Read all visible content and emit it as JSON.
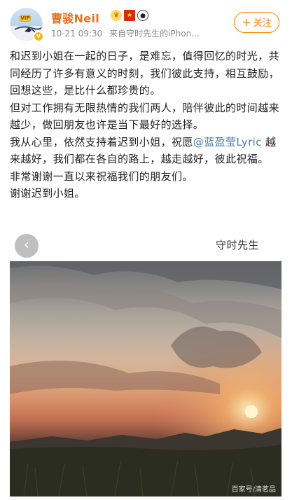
{
  "header": {
    "username": "曹骏Neil",
    "time": "10-21 09:30",
    "source": "来自守时先生的iPhon...",
    "follow_label": "关注",
    "avatar_badge": "VIP"
  },
  "post": {
    "paragraphs": [
      "和迟到小姐在一起的日子，是难忘，值得回忆的时光，共同经历了许多有意义的时刻，我们彼此支持，相互鼓励，回想这些，是比什么都珍贵的。",
      "但对工作拥有无限热情的我们两人，陪伴彼此的时间越来越少，做回朋友也许是当下最好的选择。"
    ],
    "p3_before": "我从心里，依然支持着迟到小姐，祝愿",
    "mention": "@蓝盈莹Lyric",
    "p3_after": " 越来越好，我们都在各自的路上，越走越好，彼此祝福。",
    "p4": "非常谢谢一直以来祝福我们的朋友们。",
    "p5": "谢谢迟到小姐。"
  },
  "image": {
    "caption": "守时先生",
    "watermark": "百家号/清茗品"
  },
  "icons": [
    "crown-emoji-icon",
    "china-flag-icon",
    "panda-icon",
    "verified-icon",
    "back-arrow-icon"
  ],
  "colors": {
    "username": "#e8711f",
    "accent": "#ff8200",
    "link": "#4a7aac",
    "meta": "#8a8a8a"
  }
}
